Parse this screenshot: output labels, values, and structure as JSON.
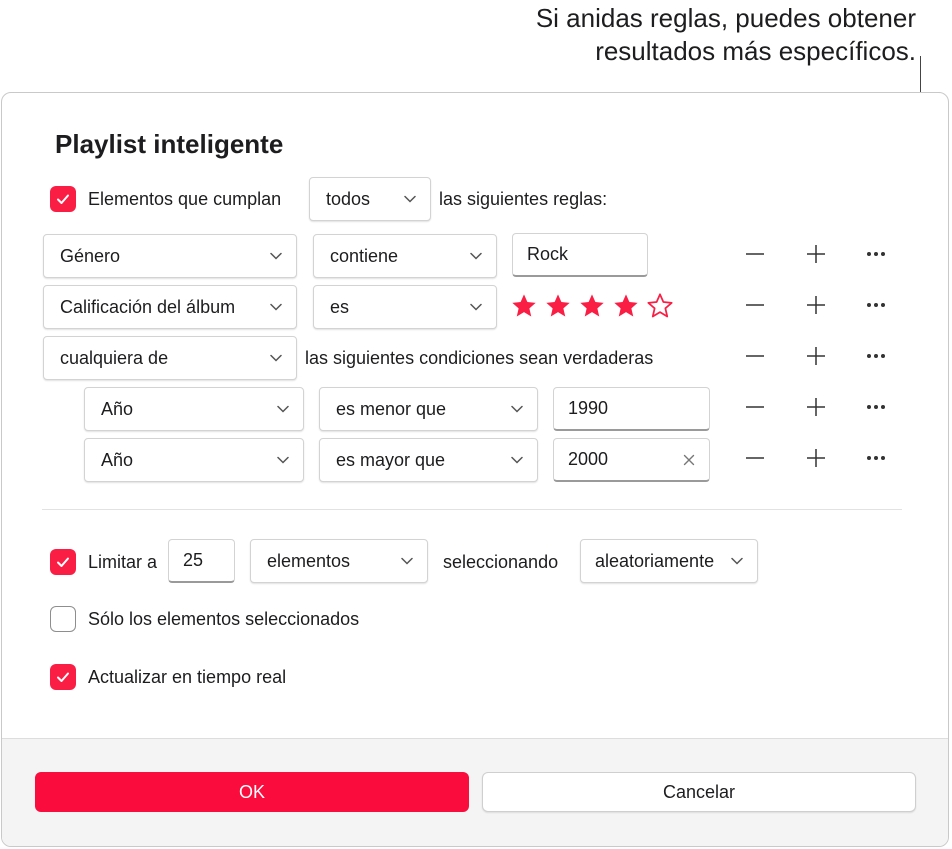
{
  "callout": {
    "line1": "Si anidas reglas, puedes obtener",
    "line2": "resultados más específicos."
  },
  "dialog": {
    "title": "Playlist inteligente",
    "match": {
      "checked": true,
      "label": "Elementos que cumplan",
      "select": "todos",
      "suffix": "las siguientes reglas:"
    },
    "rules": [
      {
        "field": "Género",
        "operator": "contiene",
        "value": "Rock"
      },
      {
        "field": "Calificación del álbum",
        "operator": "es",
        "rating": 4,
        "rating_max": 5
      },
      {
        "field": "cualquiera de",
        "text": "las siguientes condiciones sean verdaderas"
      }
    ],
    "nested_rules": [
      {
        "field": "Año",
        "operator": "es menor que",
        "value": "1990"
      },
      {
        "field": "Año",
        "operator": "es mayor que",
        "value": "2000"
      }
    ],
    "limit": {
      "checked": true,
      "label": "Limitar a",
      "value": "25",
      "unit": "elementos",
      "selecting_label": "seleccionando",
      "selecting": "aleatoriamente"
    },
    "only_selected": {
      "checked": false,
      "label": "Sólo los elementos seleccionados"
    },
    "live_update": {
      "checked": true,
      "label": "Actualizar en tiempo real"
    },
    "ok_label": "OK",
    "cancel_label": "Cancelar"
  },
  "colors": {
    "accent": "#fa1e44",
    "ok_button": "#fa0c3c",
    "text": "#1d1d1f"
  },
  "icons": [
    "checkmark-icon",
    "chevron-down-icon",
    "minus-icon",
    "plus-icon",
    "ellipsis-icon",
    "star-filled-icon",
    "star-outline-icon",
    "clear-icon"
  ]
}
